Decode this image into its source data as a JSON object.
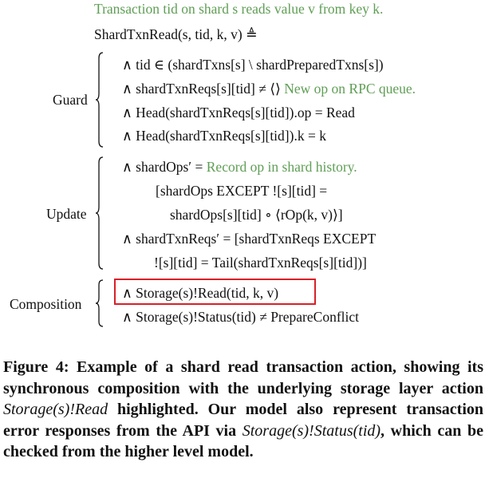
{
  "spec": {
    "comment": "Transaction tid on shard s reads value v from key k.",
    "header": "ShardTxnRead(s, tid, k, v) ≜",
    "guard": {
      "label": "Guard",
      "lines": [
        "∧ tid ∈ (shardTxns[s] \\ shardPreparedTxns[s])",
        "∧ shardTxnReqs[s][tid] ≠ ⟨⟩",
        "∧ Head(shardTxnReqs[s][tid]).op = Read",
        "∧ Head(shardTxnReqs[s][tid]).k = k"
      ],
      "line2_comment": "New op on RPC queue."
    },
    "update": {
      "label": "Update",
      "lines": [
        "∧ shardOps′ =",
        "[shardOps EXCEPT ![s][tid] =",
        "shardOps[s][tid] ∘ ⟨rOp(k, v)⟩]",
        "∧ shardTxnReqs′ = [shardTxnReqs EXCEPT",
        "![s][tid] = Tail(shardTxnReqs[s][tid])]"
      ],
      "line1_comment": "Record op in shard history."
    },
    "composition": {
      "label": "Composition",
      "lines": [
        "∧ Storage(s)!Read(tid, k, v)",
        "∧ Storage(s)!Status(tid) ≠ PrepareConflict"
      ]
    }
  },
  "caption": {
    "lead": "Figure 4: Example of a shard read transaction action, showing its synchronous composition with the underlying storage layer action",
    "ref1": "Storage(s)!Read",
    "mid": "highlighted. Our model also represent transaction error responses from the API via",
    "ref2": "Storage(s)!Status(tid)",
    "tail": ", which can be checked from the higher level model."
  },
  "colors": {
    "comment": "#5f9e55",
    "highlight_border": "#d82027",
    "text": "#111111"
  }
}
